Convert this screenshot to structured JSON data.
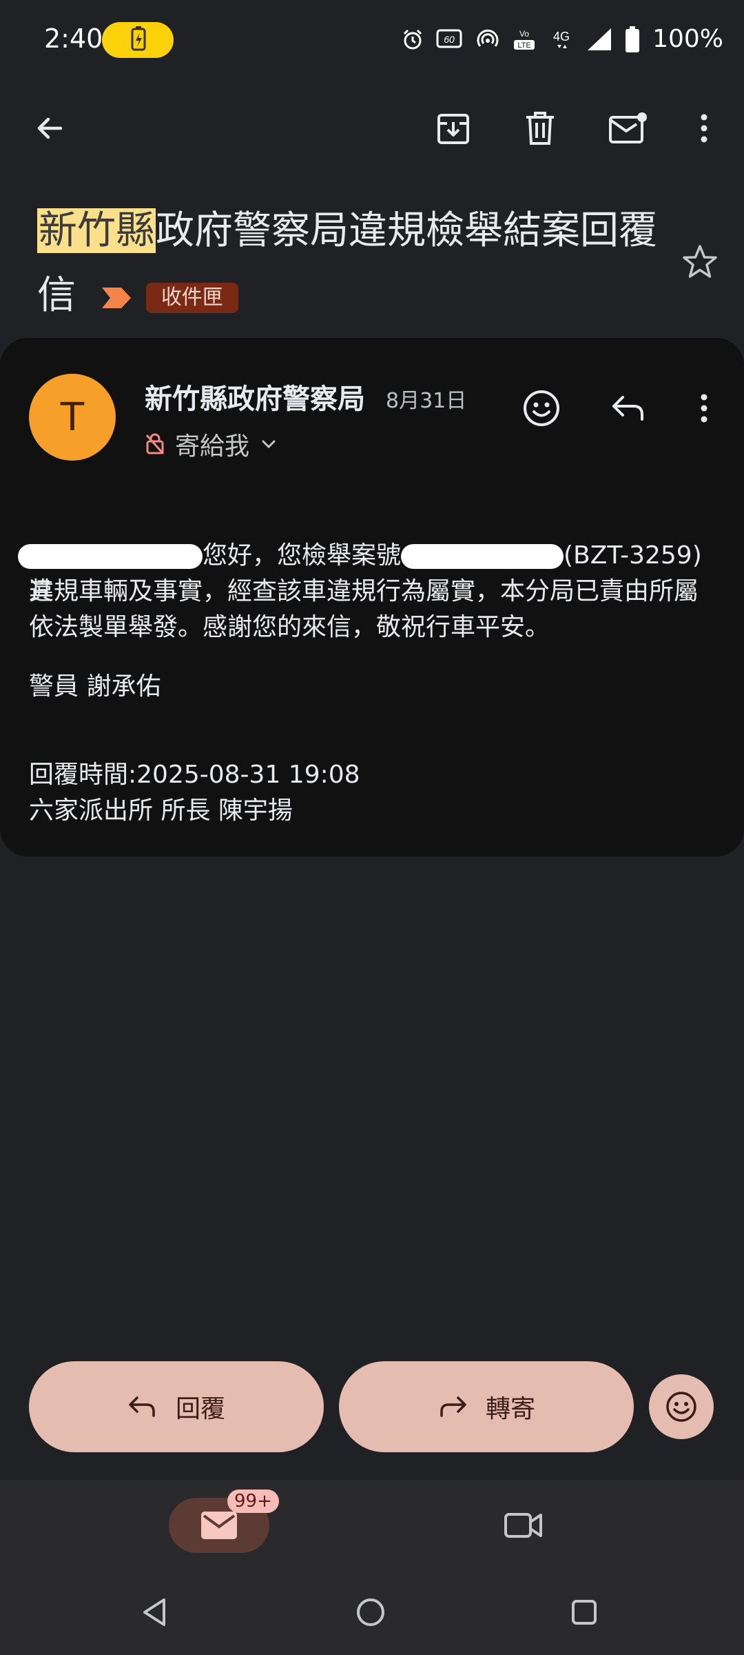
{
  "status_bar": {
    "time": "2:40",
    "network": "4G",
    "battery": "100%",
    "refresh_rate": "60"
  },
  "toolbar": {
    "icons": [
      "back-arrow-icon",
      "archive-icon",
      "delete-icon",
      "mark-unread-icon",
      "more-vert-icon"
    ]
  },
  "subject": {
    "highlighted": "新竹縣",
    "rest": "政府警察局違規檢舉結案回覆信",
    "label": "收件匣"
  },
  "message": {
    "avatar_letter": "T",
    "sender": "新竹縣政府警察局",
    "date": "8月31日",
    "to": "寄給我",
    "body": {
      "line1_a": "您好，您檢舉案號",
      "line1_b": "(BZT-3259)其",
      "line2": "違規車輛及事實，經查該車違規行為屬實，本分局已責由所屬",
      "line3": "依法製單舉發。感謝您的來信，敬祝行車平安。",
      "officer": "警員 謝承佑",
      "reply_time": "回覆時間:2025-08-31 19:08",
      "station": "六家派出所 所長 陳宇揚"
    }
  },
  "actions": {
    "reply": "回覆",
    "forward": "轉寄"
  },
  "bottom_nav": {
    "mail_badge": "99+"
  },
  "colors": {
    "background": "#202124",
    "card": "#111111",
    "avatar": "#f6a02a",
    "pill": "#e5bcb0",
    "label_chip": "#7a2a14",
    "highlight": "#fbe08c"
  }
}
